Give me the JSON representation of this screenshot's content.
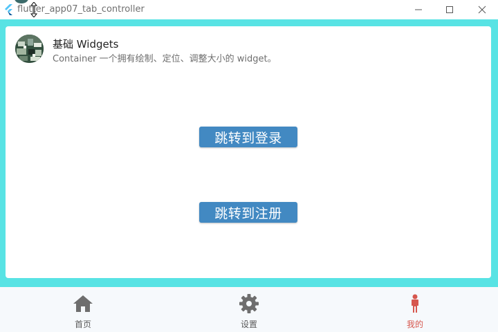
{
  "window": {
    "title": "flutter_app07_tab_controller",
    "controls": [
      "minimize",
      "maximize",
      "close"
    ]
  },
  "list_tile": {
    "title": "基础 Widgets",
    "subtitle": "Container 一个拥有绘制、定位、调整大小的 widget。",
    "avatar_icon": "avatar-image"
  },
  "buttons": {
    "login": "跳转到登录",
    "register": "跳转到注册"
  },
  "bottom_nav": {
    "items": [
      {
        "label": "首页",
        "icon": "home-icon",
        "active": false
      },
      {
        "label": "设置",
        "icon": "gear-icon",
        "active": false
      },
      {
        "label": "我的",
        "icon": "person-icon",
        "active": true
      }
    ]
  },
  "colors": {
    "body_background": "#58e3e4",
    "button": "#4289c2",
    "nav_background": "#f6f9fc",
    "active": "#d6574e",
    "inactive_icon": "#757575"
  }
}
